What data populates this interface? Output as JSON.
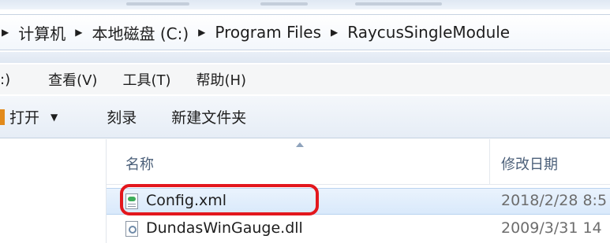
{
  "breadcrumb": {
    "items": [
      {
        "label": "计算机"
      },
      {
        "label": "本地磁盘 (C:)"
      },
      {
        "label": "Program Files"
      },
      {
        "label": "RaycusSingleModule"
      }
    ]
  },
  "menu": {
    "items": [
      {
        "label": ":)"
      },
      {
        "label": "查看(V)"
      },
      {
        "label": "工具(T)"
      },
      {
        "label": "帮助(H)"
      }
    ]
  },
  "toolbar": {
    "open_label": "打开",
    "burn_label": "刻录",
    "new_folder_label": "新建文件夹"
  },
  "file_list": {
    "columns": {
      "name": "名称",
      "modified": "修改日期"
    },
    "rows": [
      {
        "name": "Config.xml",
        "modified": "2018/2/28 8:5",
        "icon": "xml-file-icon",
        "selected": true
      },
      {
        "name": "DundasWinGauge.dll",
        "modified": "2009/3/31 14",
        "icon": "dll-file-icon",
        "selected": false
      }
    ]
  },
  "colors": {
    "highlight": "#e3171d",
    "selection": "#d9e9fb",
    "header_text": "#4c607a"
  }
}
